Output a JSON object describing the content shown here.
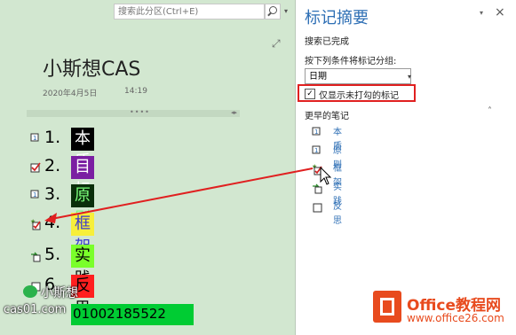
{
  "search": {
    "placeholder": "搜索此分区(Ctrl+E)"
  },
  "note": {
    "title": "小斯想CAS",
    "date": "2020年4月5日",
    "time": "14:19",
    "items": [
      {
        "num": "1.",
        "text": "本质",
        "bg": "#000000",
        "fg": "#ffffff",
        "tag": "numbered"
      },
      {
        "num": "2.",
        "text": "目标",
        "bg": "#7b1fa2",
        "fg": "#ffffff",
        "tag": "checked-numbered"
      },
      {
        "num": "3.",
        "text": "原则",
        "bg": "#0a2e0a",
        "fg": "#7cff7c",
        "tag": "numbered"
      },
      {
        "num": "4.",
        "text": "框架",
        "bg": "#f7ef3a",
        "fg": "#3a3ad0",
        "tag": "star-check"
      },
      {
        "num": "5.",
        "text": "实践",
        "bg": "#7aff2a",
        "fg": "#000000",
        "tag": "arrow"
      },
      {
        "num": "6.",
        "text": "反思",
        "bg": "#ff1f1f",
        "fg": "#000000",
        "tag": "box"
      }
    ]
  },
  "watermark": {
    "wechat_name": "小斯想",
    "cas_url": "cas01.com",
    "bottom_text": "01002185522"
  },
  "pane": {
    "title": "标记摘要",
    "status": "搜索已完成",
    "group_label": "按下列条件将标记分组:",
    "group_value": "日期",
    "checkbox_label": "仅显示未打勾的标记",
    "checkbox_checked": true,
    "section": "更早的笔记",
    "tags": [
      {
        "label": "本质",
        "icon": "numbered"
      },
      {
        "label": "原则",
        "icon": "numbered"
      },
      {
        "label": "框架",
        "icon": "star-check"
      },
      {
        "label": "实践",
        "icon": "arrow"
      },
      {
        "label": "反思",
        "icon": "box"
      }
    ]
  },
  "branding": {
    "office_text": "Office教程网",
    "office_url": "www.office26.com"
  },
  "colors": {
    "accent": "#2e6fb5",
    "page_bg": "#d2e7d0",
    "highlight": "#e02020",
    "brand": "#e84b1e"
  }
}
